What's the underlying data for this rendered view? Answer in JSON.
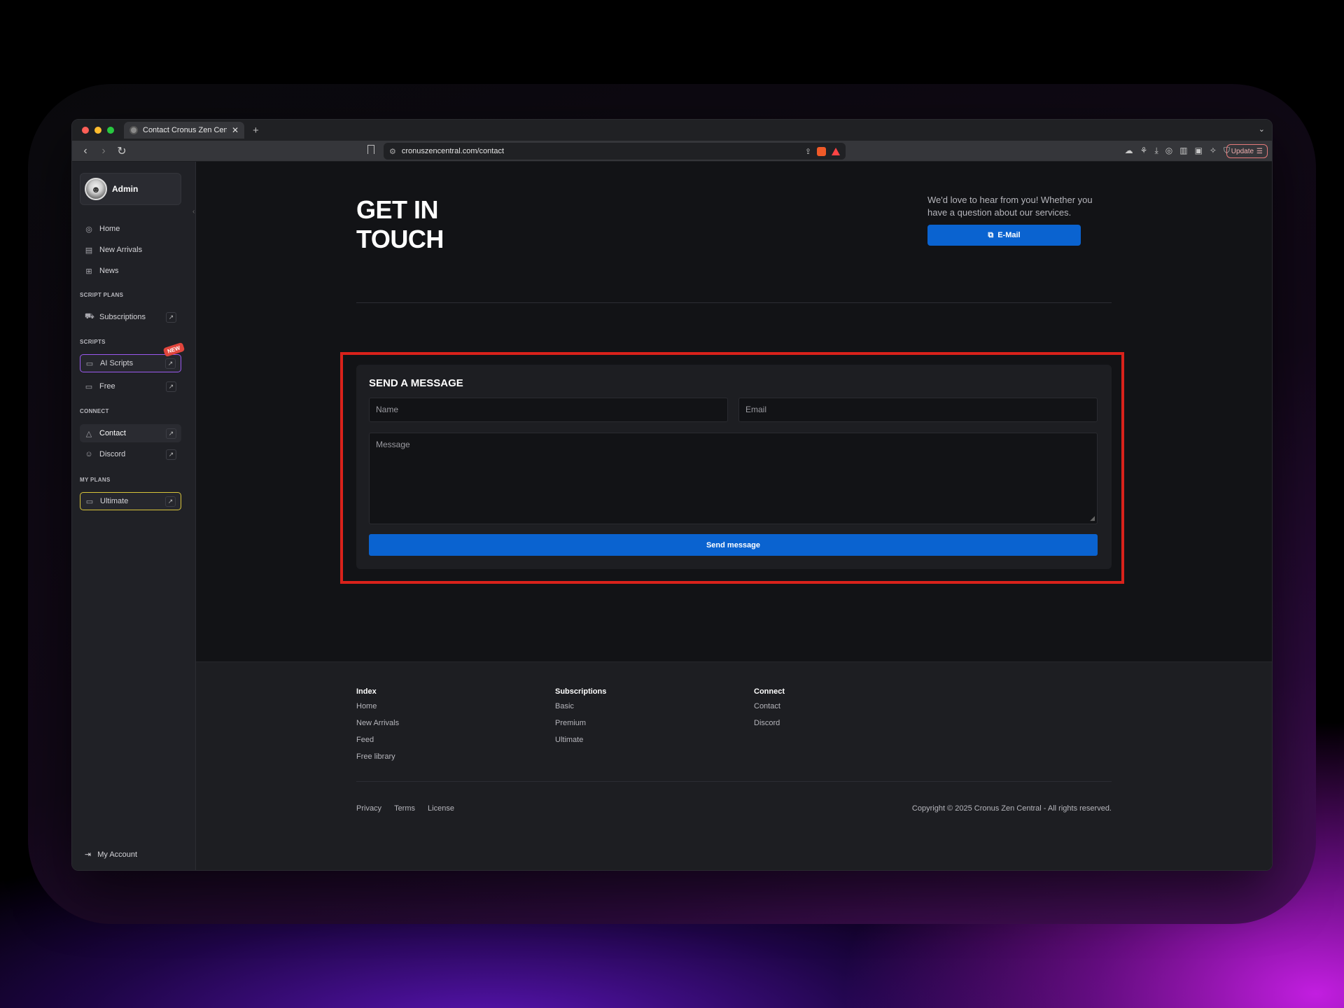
{
  "browser": {
    "tab_title": "Contact Cronus Zen Central |",
    "tab_close": "✕",
    "new_tab": "+",
    "url": "cronuszencentral.com/contact",
    "update_label": "Update"
  },
  "sidebar": {
    "user_name": "Admin",
    "items": [
      {
        "label": "Home",
        "icon": "compass-icon"
      },
      {
        "label": "New Arrivals",
        "icon": "database-icon"
      },
      {
        "label": "News",
        "icon": "grid-plus-icon"
      }
    ],
    "section_script_plans": "SCRIPT PLANS",
    "subscriptions_label": "Subscriptions",
    "section_scripts": "SCRIPTS",
    "ai_scripts_label": "AI Scripts",
    "new_badge": "NEW",
    "free_label": "Free",
    "section_connect": "CONNECT",
    "contact_label": "Contact",
    "discord_label": "Discord",
    "section_my_plans": "MY PLANS",
    "ultimate_label": "Ultimate",
    "account_label": "My Account"
  },
  "hero": {
    "title_line1": "GET IN",
    "title_line2": "TOUCH",
    "description": "We'd love to hear from you! Whether you have a question about our services.",
    "email_button": "E-Mail"
  },
  "form": {
    "title": "SEND A MESSAGE",
    "name_placeholder": "Name",
    "email_placeholder": "Email",
    "message_placeholder": "Message",
    "submit_label": "Send message"
  },
  "footer": {
    "columns": [
      {
        "heading": "Index",
        "links": [
          "Home",
          "New Arrivals",
          "Feed",
          "Free library"
        ]
      },
      {
        "heading": "Subscriptions",
        "links": [
          "Basic",
          "Premium",
          "Ultimate"
        ]
      },
      {
        "heading": "Connect",
        "links": [
          "Contact",
          "Discord"
        ]
      }
    ],
    "legal": [
      "Privacy",
      "Terms",
      "License"
    ],
    "copyright": "Copyright © 2025 Cronus Zen Central - All rights reserved."
  },
  "colors": {
    "accent_blue": "#0a63d0",
    "highlight_red": "#d9221b",
    "ai_scripts_border": "#9b59f0",
    "ultimate_border": "#d9c53a"
  }
}
